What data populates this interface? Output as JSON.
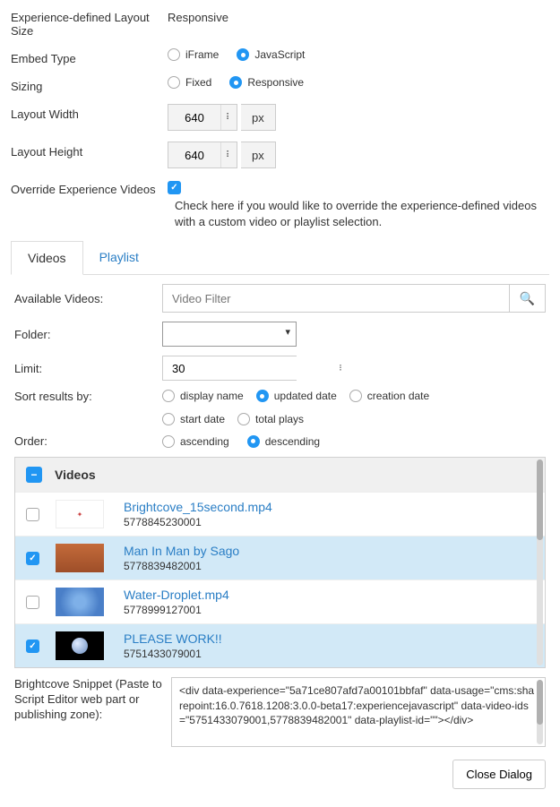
{
  "form": {
    "layoutSizeLabel": "Experience-defined Layout Size",
    "layoutSizeValue": "Responsive",
    "embedTypeLabel": "Embed Type",
    "embedType": {
      "opt1": "iFrame",
      "opt2": "JavaScript"
    },
    "sizingLabel": "Sizing",
    "sizing": {
      "opt1": "Fixed",
      "opt2": "Responsive"
    },
    "layoutWidthLabel": "Layout Width",
    "layoutWidthValue": "640",
    "layoutHeightLabel": "Layout Height",
    "layoutHeightValue": "640",
    "unit": "px",
    "overrideLabel": "Override Experience Videos",
    "overrideText": "Check here if you would like to override the experience-defined videos with a custom video or playlist selection."
  },
  "tabs": {
    "videos": "Videos",
    "playlist": "Playlist"
  },
  "panel": {
    "availableLabel": "Available Videos:",
    "filterPlaceholder": "Video Filter",
    "folderLabel": "Folder:",
    "limitLabel": "Limit:",
    "limitValue": "30",
    "sortLabel": "Sort results by:",
    "sortOptions": {
      "o1": "display name",
      "o2": "updated date",
      "o3": "creation date",
      "o4": "start date",
      "o5": "total plays"
    },
    "orderLabel": "Order:",
    "orderOptions": {
      "o1": "ascending",
      "o2": "descending"
    }
  },
  "list": {
    "header": "Videos",
    "rows": [
      {
        "title": "Brightcove_15second.mp4",
        "id": "5778845230001"
      },
      {
        "title": "Man In Man by Sago",
        "id": "5778839482001"
      },
      {
        "title": "Water-Droplet.mp4",
        "id": "5778999127001"
      },
      {
        "title": "PLEASE WORK!!",
        "id": "5751433079001"
      }
    ]
  },
  "snippet": {
    "label": "Brightcove Snippet (Paste to Script Editor web part or publishing zone):",
    "value": "<div data-experience=\"5a71ce807afd7a00101bbfaf\" data-usage=\"cms:sharepoint:16.0.7618.1208:3.0.0-beta17:experiencejavascript\" data-video-ids=\"5751433079001,5778839482001\" data-playlist-id=\"\"></div>"
  },
  "closeLabel": "Close Dialog"
}
